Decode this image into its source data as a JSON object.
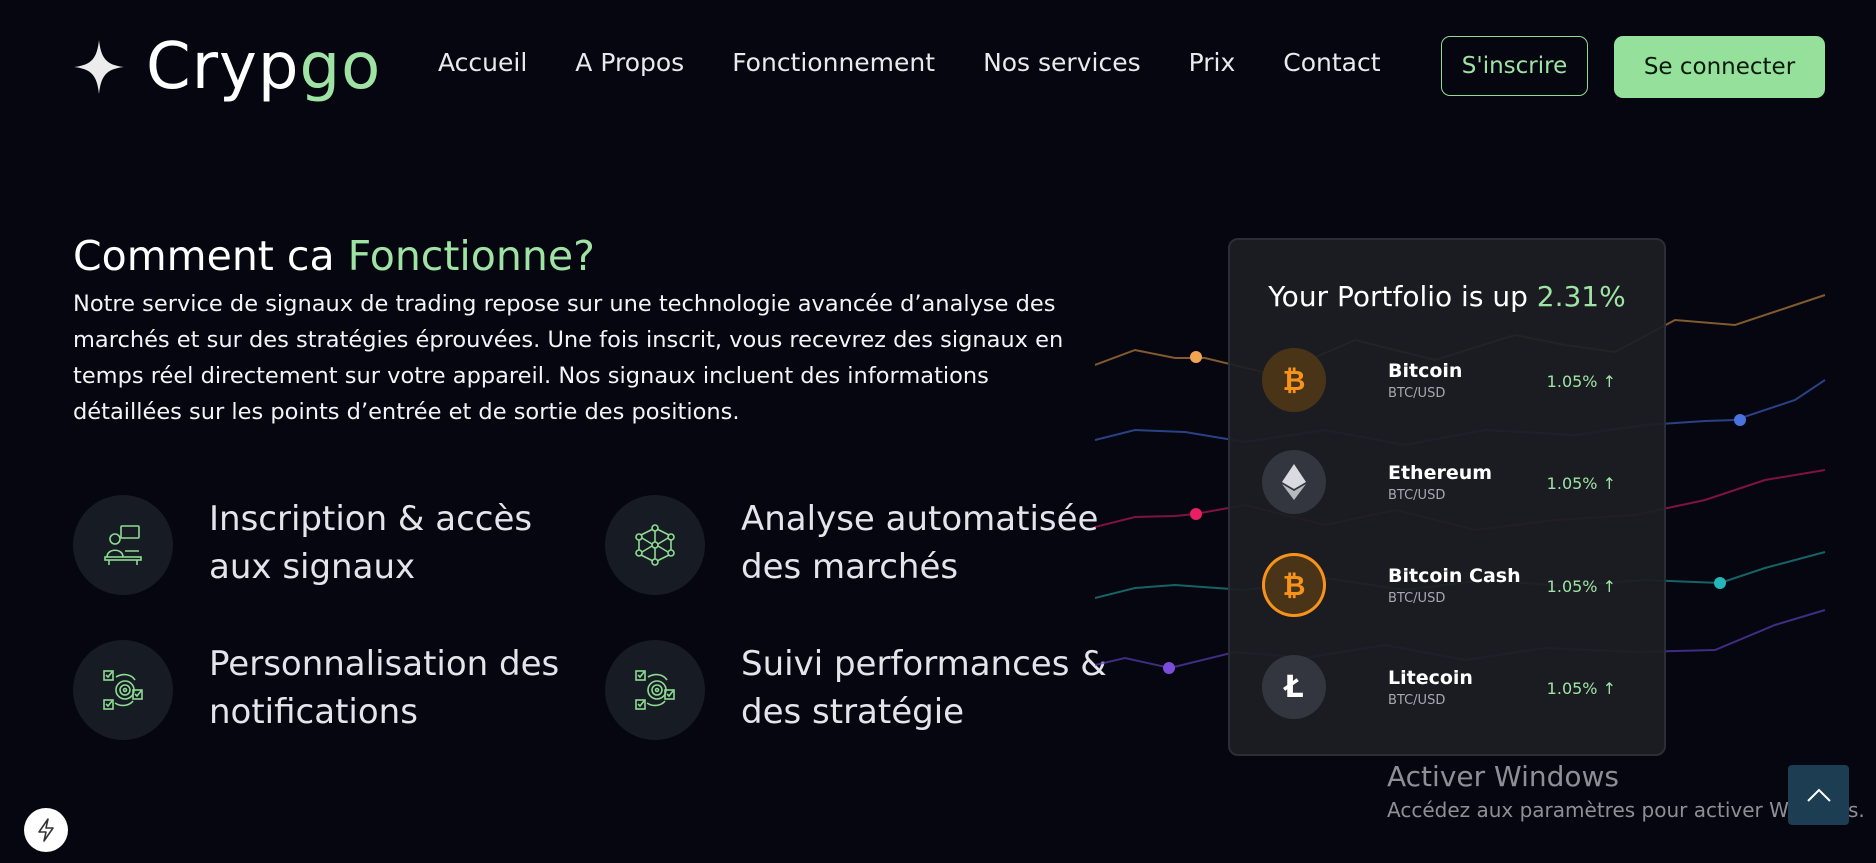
{
  "brand": {
    "part1": "Cryp",
    "part2": "go",
    "icon": "sparkle-icon",
    "accent": "#9fe3a4"
  },
  "nav": {
    "items": [
      "Accueil",
      "A Propos",
      "Fonctionnement",
      "Nos services",
      "Prix",
      "Contact"
    ]
  },
  "actions": {
    "signup": "S'inscrire",
    "login": "Se connecter"
  },
  "section": {
    "title_main": "Comment ca ",
    "title_accent": "Fonctionne?",
    "description": "Notre service de signaux de trading repose sur une technologie avancée d’analyse des marchés et sur des stratégies éprouvées. Une fois inscrit, vous recevrez des signaux en temps réel directement sur votre appareil. Nos signaux incluent des informations détaillées sur les points d’entrée et de sortie des positions."
  },
  "features": [
    {
      "label": "Inscription & accès aux signaux",
      "icon": "user-desk-icon"
    },
    {
      "label": "Analyse automatisée des marchés",
      "icon": "network-cube-icon"
    },
    {
      "label": "Personnalisation des notifications",
      "icon": "target-checklist-icon"
    },
    {
      "label": "Suivi performances & des stratégie",
      "icon": "target-checklist-icon"
    }
  ],
  "portfolio": {
    "title": "Your Portfolio is up ",
    "change": "2.31%",
    "coins": [
      {
        "name": "Bitcoin",
        "pair": "BTC/USD",
        "change": "1.05% ↑",
        "icon": "bitcoin-icon",
        "color": "#f7931a"
      },
      {
        "name": "Ethereum",
        "pair": "BTC/USD",
        "change": "1.05% ↑",
        "icon": "ethereum-icon",
        "color": "#cfd1d6"
      },
      {
        "name": "Bitcoin Cash",
        "pair": "BTC/USD",
        "change": "1.05% ↑",
        "icon": "bitcoin-cash-icon",
        "color": "#f7931a"
      },
      {
        "name": "Litecoin",
        "pair": "BTC/USD",
        "change": "1.05% ↑",
        "icon": "litecoin-icon",
        "color": "#ffffff"
      }
    ]
  },
  "watermark": {
    "title": "Activer Windows",
    "subtitle": "Accédez aux paramètres pour activer Windows."
  },
  "widgets": {
    "scroll_top_icon": "chevron-up-icon",
    "bolt_icon": "lightning-icon"
  }
}
